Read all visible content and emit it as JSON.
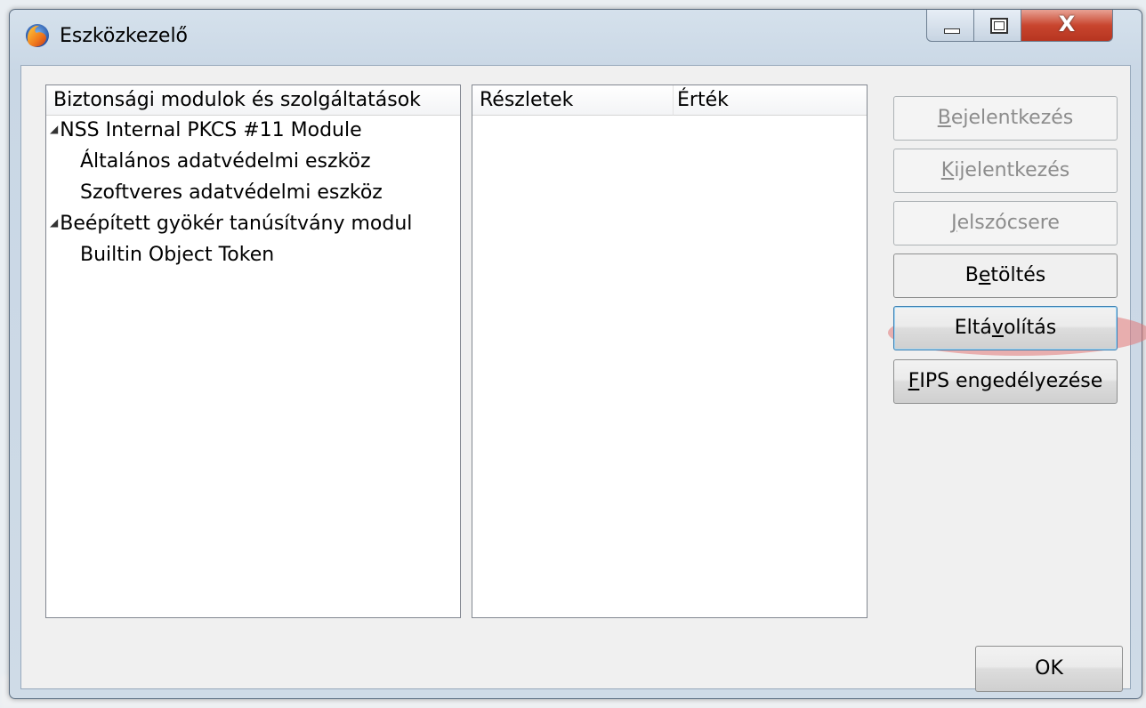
{
  "window": {
    "title": "Eszközkezelő",
    "close_glyph": "X"
  },
  "modules": {
    "header": "Biztonsági modulok és szolgáltatások",
    "items": [
      {
        "label": "NSS Internal PKCS #11 Module",
        "expanded": true,
        "level": 0
      },
      {
        "label": "Általános adatvédelmi eszköz",
        "level": 1
      },
      {
        "label": "Szoftveres adatvédelmi eszköz",
        "level": 1
      },
      {
        "label": "Beépített gyökér tanúsítvány modul",
        "expanded": true,
        "level": 0
      },
      {
        "label": "Builtin Object Token",
        "level": 1
      }
    ],
    "twisty_glyph": "◢"
  },
  "details": {
    "col1": "Részletek",
    "col2": "Érték"
  },
  "buttons": {
    "login": {
      "pre": "",
      "key": "B",
      "post": "ejelentkezés",
      "enabled": false
    },
    "logout": {
      "pre": "",
      "key": "K",
      "post": "ijelentkezés",
      "enabled": false
    },
    "change_password": {
      "pre": "",
      "key": "J",
      "post": "elszócsere",
      "enabled": false
    },
    "load": {
      "pre": "B",
      "key": "e",
      "post": "töltés",
      "enabled": true,
      "highlighted": true
    },
    "unload": {
      "pre": "Eltá",
      "key": "v",
      "post": "olítás",
      "enabled": true
    },
    "fips": {
      "pre": "",
      "key": "F",
      "post": "IPS engedélyezése",
      "enabled": true
    },
    "ok": "OK"
  },
  "colors": {
    "highlight": "#e27878",
    "close_button": "#c8452e"
  },
  "icons": {
    "app": "firefox-icon"
  }
}
